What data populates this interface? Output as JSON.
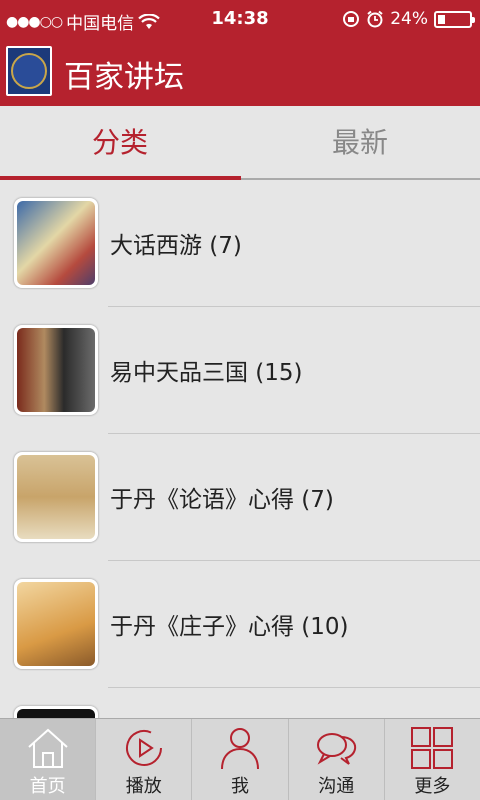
{
  "status_bar": {
    "signal_dots": "●●●○○",
    "carrier": "中国电信",
    "time": "14:38",
    "battery": "24%",
    "battery_level": 0.24
  },
  "header": {
    "title": "百家讲坛"
  },
  "tabs": [
    {
      "label": "分类",
      "active": true
    },
    {
      "label": "最新",
      "active": false
    }
  ],
  "list": [
    {
      "title": "大话西游 (7)"
    },
    {
      "title": "易中天品三国 (15)"
    },
    {
      "title": "于丹《论语》心得 (7)"
    },
    {
      "title": "于丹《庄子》心得 (10)"
    }
  ],
  "bottom_nav": [
    {
      "label": "首页",
      "icon": "home-icon"
    },
    {
      "label": "播放",
      "icon": "play-icon"
    },
    {
      "label": "我",
      "icon": "user-icon"
    },
    {
      "label": "沟通",
      "icon": "chat-icon"
    },
    {
      "label": "更多",
      "icon": "grid-icon"
    }
  ],
  "colors": {
    "brand": "#b5222e",
    "background": "#e6e6e6",
    "nav": "#d7d7d7"
  }
}
